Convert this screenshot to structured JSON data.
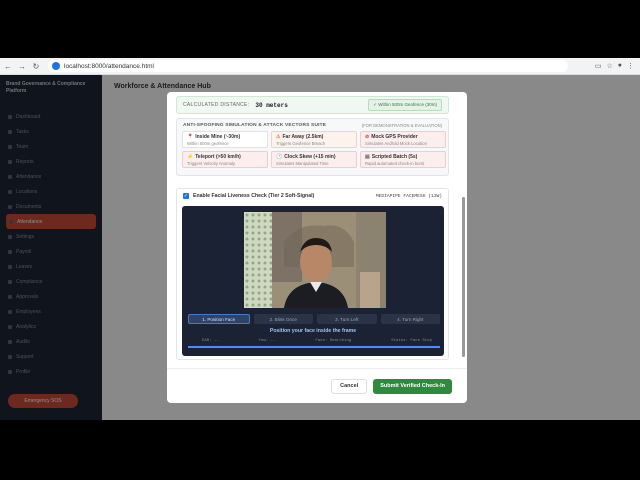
{
  "browser": {
    "url": "localhost:8000/attendance.html"
  },
  "sidebar": {
    "brand": "Brand Governance & Compliance Platform",
    "items": [
      "Dashboard",
      "Tasks",
      "Team",
      "Reports",
      "Attendance",
      "Locations",
      "Documents",
      "Attendance",
      "Settings",
      "Payroll",
      "Leaves",
      "Compliance",
      "Approvals",
      "Employees",
      "Analytics",
      "Audits",
      "Support",
      "Profile"
    ],
    "bottom_button": "Emergency SOS"
  },
  "main": {
    "title": "Workforce & Attendance Hub"
  },
  "distance": {
    "label": "CALCULATED DISTANCE:",
    "value": "30 meters",
    "badge": "✓ Within 500m Geofence (30m)"
  },
  "suite": {
    "title": "ANTI-SPOOFING SIMULATION & ATTACK VECTORS SUITE",
    "note": "(FOR DEMONSTRATION & EVALUATION)",
    "vectors": [
      {
        "icon": "📍",
        "title": "Inside Mine (~30m)",
        "sub": "Within 500m geofence"
      },
      {
        "icon": "⚠",
        "title": "Far Away (2.5km)",
        "sub": "Triggers Geofence Breach"
      },
      {
        "icon": "⊘",
        "title": "Mock GPS Provider",
        "sub": "Simulates Android Mock Location"
      },
      {
        "icon": "⚡",
        "title": "Teleport (>50 km/h)",
        "sub": "Triggers Velocity Anomaly"
      },
      {
        "icon": "🕐",
        "title": "Clock Skew (+15 min)",
        "sub": "Simulates Manipulated Time"
      },
      {
        "icon": "▤",
        "title": "Scripted Batch (5s)",
        "sub": "Rapid automated check-in burst"
      }
    ]
  },
  "liveness": {
    "label": "Enable Facial Liveness Check (Tier 2 Soft-Signal)",
    "model": "MEDIAPIPE FACEMESH (13W)",
    "steps": [
      "1. Position Face",
      "2. Blink Once",
      "3. Turn Left",
      "4. Turn Right"
    ],
    "prompt": "Position your face inside the frame",
    "telemetry": [
      "EAR: --",
      "Yaw: --",
      "Face: Searching",
      "Status: Face Stop"
    ],
    "progress": 1.0
  },
  "footer": {
    "cancel": "Cancel",
    "submit": "Submit Verified Check-In"
  },
  "colors": {
    "accent": "#2e8b3e",
    "camera_bg": "#1a2234",
    "sidebar_active": "#c94b3a"
  }
}
